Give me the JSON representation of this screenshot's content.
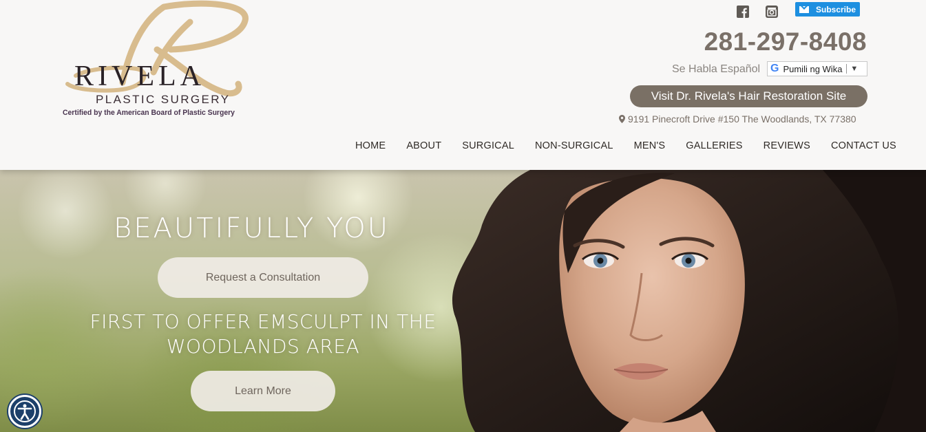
{
  "logo": {
    "brand": "RIVELA",
    "subtitle": "PLASTIC SURGERY",
    "certification": "Certified by the American Board of Plastic Surgery"
  },
  "top_bar": {
    "social_icons": [
      "facebook-icon",
      "instagram-icon"
    ],
    "subscribe_label": "Subscribe",
    "phone": "281-297-8408",
    "habla": "Se Habla Español",
    "translate_label": "Pumili ng Wika",
    "hair_restoration_button": "Visit Dr. Rivela's Hair Restoration Site",
    "address": "9191 Pinecroft Drive #150 The Woodlands, TX 77380"
  },
  "nav": {
    "items": [
      "HOME",
      "ABOUT",
      "SURGICAL",
      "NON-SURGICAL",
      "MEN'S",
      "GALLERIES",
      "REVIEWS",
      "CONTACT US"
    ]
  },
  "hero": {
    "title": "BEAUTIFULLY YOU",
    "consult_button": "Request a Consultation",
    "headline": "FIRST TO OFFER EMSCULPT IN THE WOODLANDS AREA",
    "learn_more_button": "Learn More"
  },
  "colors": {
    "accent": "#7a7065",
    "logo_gold": "#d8bc8e",
    "subscribe_blue": "#1d8fe0",
    "accessibility_blue": "#1c3f6a"
  }
}
